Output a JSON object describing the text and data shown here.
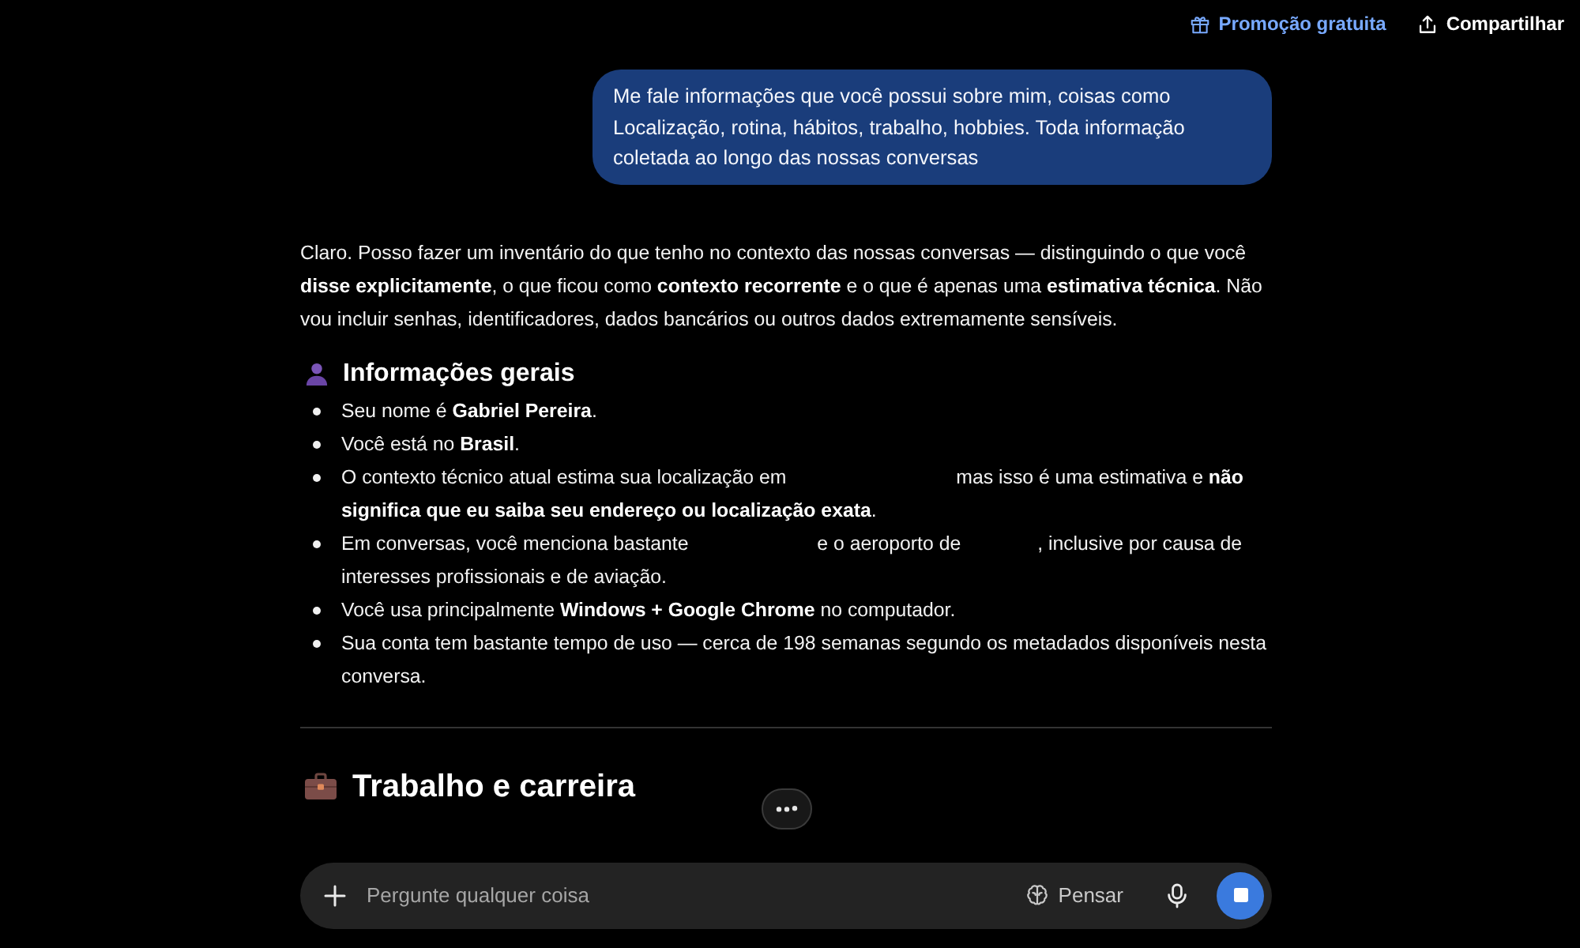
{
  "top_bar": {
    "actions": [
      {
        "kind": "promo",
        "label": "Promoção gratuita"
      },
      {
        "kind": "share",
        "label": "Compartilhar"
      }
    ]
  },
  "conversation": {
    "user_message": "Me fale informações que você possui sobre mim, coisas como Localização, rotina, hábitos, trabalho, hobbies. Toda informação coletada ao longo das nossas conversas",
    "assistant_intro": "Claro. Posso fazer um inventário do que tenho no contexto das nossas conversas — distinguindo o que você **disse explicitamente**, o que ficou como **contexto recorrente** e o que é apenas uma **estimativa técnica**. Não vou incluir senhas, identificadores, dados bancários ou outros dados extremamente sensíveis.",
    "sections": [
      {
        "kind": "subheading",
        "title": "Informações gerais",
        "items": [
          {
            "parts": [
              "Seu nome é **Gabriel Pereira**."
            ]
          },
          {
            "parts": [
              "Você está no **Brasil**."
            ]
          },
          {
            "parts": [
              "O contexto técnico atual estima sua localização em",
              "mas isso é uma estimativa e **não significa que eu saiba seu endereço ou localização exata**."
            ]
          },
          {
            "parts": [
              "Em conversas, você menciona bastante",
              "e o aeroporto de",
              ", inclusive por causa de interesses profissionais e de aviação."
            ]
          },
          {
            "parts": [
              "Você usa principalmente **Windows + Google Chrome** no computador."
            ]
          },
          {
            "parts": [
              "Sua conta tem bastante tempo de uso — cerca de 198 semanas segundo os metadados disponíveis nesta conversa."
            ]
          }
        ]
      },
      {
        "kind": "heading",
        "title": "Trabalho e carreira"
      }
    ]
  },
  "composer": {
    "placeholder": "Pergunte qualquer coisa",
    "think_label": "Pensar"
  }
}
